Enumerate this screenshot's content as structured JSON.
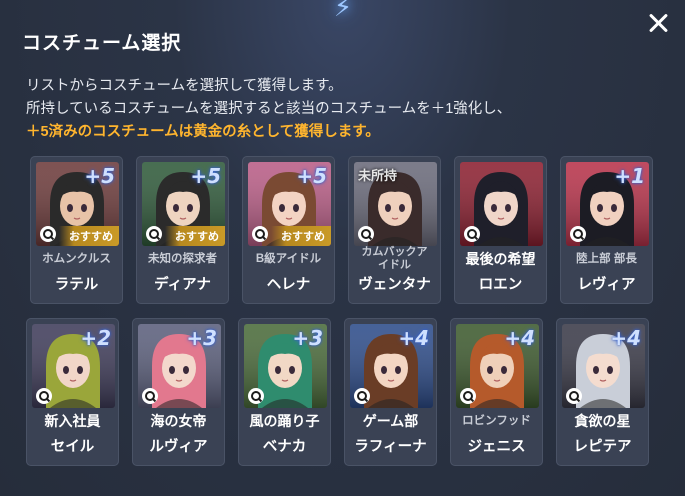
{
  "modal": {
    "title": "コスチューム選択",
    "desc_line1": "リストからコスチュームを選択して獲得します。",
    "desc_line2": "所持しているコスチュームを選択すると該当のコスチュームを＋1強化し、",
    "desc_line3": "＋5済みのコスチュームは黄金の糸として獲得します。"
  },
  "colors": {
    "highlight": "#ffb52e",
    "recommend_badge": "#c99a27",
    "card_bg": "#3a4254"
  },
  "cards": [
    {
      "subtitle": "ホムンクルス",
      "name": "ラテル",
      "plus": "+5",
      "badge": "おすすめ",
      "bg": "#6d3b3b",
      "hair": "#2a2a2a",
      "skin": "#e8c3a8"
    },
    {
      "subtitle": "未知の探求者",
      "name": "ディアナ",
      "plus": "+5",
      "badge": "おすすめ",
      "bg": "#2f5a3a",
      "hair": "#2b2b2b",
      "skin": "#eed4c0"
    },
    {
      "subtitle": "B級アイドル",
      "name": "ヘレナ",
      "plus": "+5",
      "badge": "おすすめ",
      "bg": "#b95d86",
      "hair": "#7a4a33",
      "skin": "#f3d3c3"
    },
    {
      "subtitle": "カムバックアイドル",
      "name": "ヴェンタナ",
      "status": "未所持",
      "bg": "#6a6a7a",
      "hair": "#3a2b2b",
      "skin": "#efd0bd"
    },
    {
      "subtitle": "最後の希望",
      "name": "ロエン",
      "bg": "#8c1f30",
      "hair": "#1f1f2a",
      "skin": "#f0d6c9"
    },
    {
      "subtitle": "陸上部 部長",
      "name": "レヴィア",
      "plus": "+1",
      "bg": "#b8324a",
      "hair": "#1c1c24",
      "skin": "#f1d1c0"
    },
    {
      "subtitle": "新入社員",
      "name": "セイル",
      "plus": "+2",
      "bg": "#3f3c5a",
      "hair": "#9aa63a",
      "skin": "#f1d6c8"
    },
    {
      "subtitle": "海の女帝",
      "name": "ルヴィア",
      "plus": "+3",
      "bg": "#5b5f7c",
      "hair": "#e2788e",
      "skin": "#f3d8cc"
    },
    {
      "subtitle": "風の踊り子",
      "name": "ベナカ",
      "plus": "+3",
      "bg": "#4a6b3a",
      "hair": "#2f8c6e",
      "skin": "#f1d8c5"
    },
    {
      "subtitle": "ゲーム部",
      "name": "ラフィーナ",
      "plus": "+4",
      "bg": "#2d4c8a",
      "hair": "#6a3d26",
      "skin": "#f3d6c3"
    },
    {
      "subtitle": "ロビンフッド",
      "name": "ジェニス",
      "plus": "+4",
      "bg": "#3d5a2e",
      "hair": "#b55a2b",
      "skin": "#efd0b9"
    },
    {
      "subtitle": "貪欲の星",
      "name": "レピテア",
      "plus": "+4",
      "bg": "#3a3a48",
      "hair": "#c9ced8",
      "skin": "#f4dccf"
    }
  ]
}
